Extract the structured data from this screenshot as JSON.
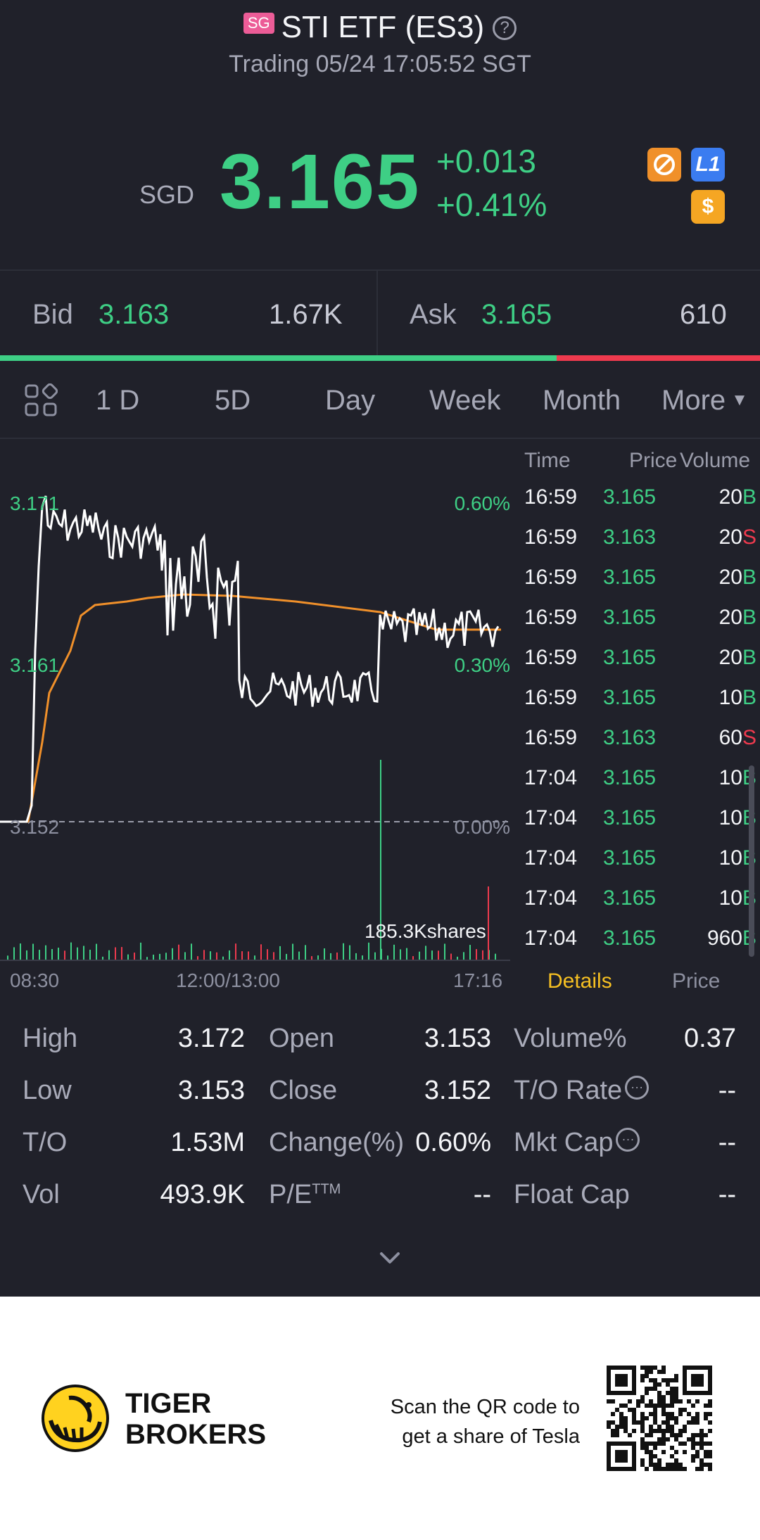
{
  "header": {
    "market_tag": "SG",
    "title": "STI ETF (ES3)",
    "help_icon": "question-icon",
    "subtitle": "Trading 05/24 17:05:52 SGT"
  },
  "quote": {
    "currency": "SGD",
    "price": "3.165",
    "change": "+0.013",
    "change_pct": "+0.41%",
    "badges": [
      "no-shorting-icon",
      "L1",
      "dollar-icon"
    ],
    "badge_l1": "L1",
    "badge_dollar": "$"
  },
  "bid_ask": {
    "bid_label": "Bid",
    "bid_price": "3.163",
    "bid_size": "1.67K",
    "ask_label": "Ask",
    "ask_price": "3.165",
    "ask_size": "610",
    "bid_ratio": 0.732
  },
  "tabs": {
    "grid_icon": "grid-icon",
    "items": [
      "1 D",
      "5D",
      "Day",
      "Week",
      "Month",
      "More"
    ],
    "active": "1 D"
  },
  "chart_data": {
    "type": "line",
    "price_labels": {
      "top": "3.171",
      "mid": "3.161",
      "base": "3.152"
    },
    "pct_labels": {
      "top": "0.60%",
      "mid": "0.30%",
      "base": "0.00%"
    },
    "x_labels": [
      "08:30",
      "12:00/13:00",
      "17:16"
    ],
    "volume_peak_label": "185.3Kshares",
    "series": [
      {
        "color": "#ffffff"
      },
      {
        "color": "#f0902a"
      }
    ]
  },
  "trades": {
    "headers": {
      "time": "Time",
      "price": "Price",
      "volume": "Volume"
    },
    "rows": [
      {
        "time": "16:59",
        "price": "3.165",
        "volume": "20",
        "side": "B"
      },
      {
        "time": "16:59",
        "price": "3.163",
        "volume": "20",
        "side": "S"
      },
      {
        "time": "16:59",
        "price": "3.165",
        "volume": "20",
        "side": "B"
      },
      {
        "time": "16:59",
        "price": "3.165",
        "volume": "20",
        "side": "B"
      },
      {
        "time": "16:59",
        "price": "3.165",
        "volume": "20",
        "side": "B"
      },
      {
        "time": "16:59",
        "price": "3.165",
        "volume": "10",
        "side": "B"
      },
      {
        "time": "16:59",
        "price": "3.163",
        "volume": "60",
        "side": "S"
      },
      {
        "time": "17:04",
        "price": "3.165",
        "volume": "10",
        "side": "B"
      },
      {
        "time": "17:04",
        "price": "3.165",
        "volume": "10",
        "side": "B"
      },
      {
        "time": "17:04",
        "price": "3.165",
        "volume": "10",
        "side": "B"
      },
      {
        "time": "17:04",
        "price": "3.165",
        "volume": "10",
        "side": "B"
      },
      {
        "time": "17:04",
        "price": "3.165",
        "volume": "960",
        "side": "B"
      }
    ],
    "tab_details": "Details",
    "tab_price": "Price"
  },
  "stats": {
    "high_label": "High",
    "high": "3.172",
    "low_label": "Low",
    "low": "3.153",
    "to_label": "T/O",
    "to": "1.53M",
    "vol_label": "Vol",
    "vol": "493.9K",
    "open_label": "Open",
    "open": "3.153",
    "close_label": "Close",
    "close": "3.152",
    "change_label": "Change(%)",
    "change": "0.60%",
    "pe_label": "P/E",
    "pe_sup": "TTM",
    "pe": "--",
    "volpct_label": "Volume%",
    "volpct": "0.37",
    "torate_label": "T/O Rate",
    "torate": "--",
    "mktcap_label": "Mkt Cap",
    "mktcap": "--",
    "floatcap_label": "Float Cap",
    "floatcap": "--",
    "expand_icon": "chevron-down-icon"
  },
  "footer": {
    "brand_line1": "TIGER",
    "brand_line2": "BROKERS",
    "promo_line1": "Scan the QR code to",
    "promo_line2": "get a share of Tesla",
    "qr_icon": "qr-code-icon"
  }
}
